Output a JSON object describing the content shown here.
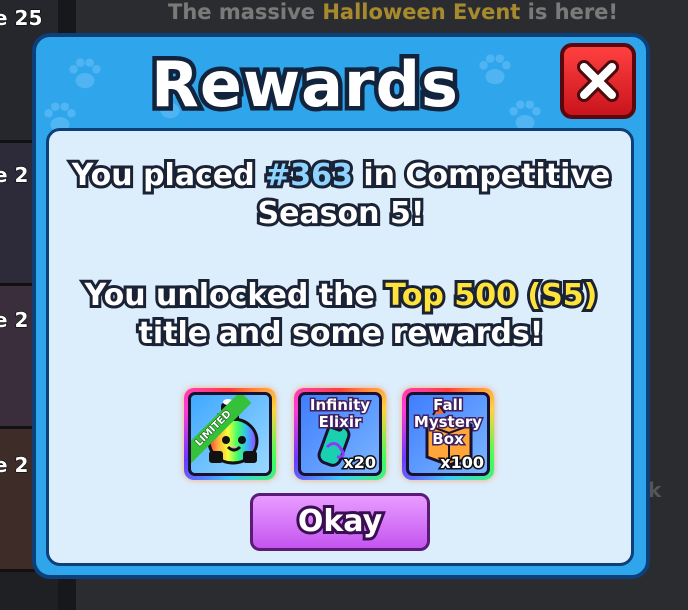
{
  "background": {
    "banner_prefix": "The massive ",
    "banner_highlight": "Halloween Event",
    "banner_suffix": " is here!",
    "side_labels": [
      "e 25",
      "e 2",
      "e 2",
      "e 2"
    ],
    "edge_glyph": "k"
  },
  "modal": {
    "title": "Rewards",
    "close_glyph": "X",
    "line1_prefix": "You placed ",
    "line1_rank": "#363",
    "line1_suffix": " in Competitive",
    "line2": "Season 5!",
    "line3_prefix": "You unlocked the ",
    "line3_title": "Top 500 (S5)",
    "line4": "title and some rewards!",
    "items": [
      {
        "name": "",
        "qty": "",
        "ribbon": "LIMITED"
      },
      {
        "name": "Infinity Elixir",
        "qty": "x20",
        "ribbon": ""
      },
      {
        "name": "Fall Mystery Box",
        "qty": "x100",
        "ribbon": ""
      }
    ],
    "okay_label": "Okay"
  },
  "colors": {
    "modal_bg": "#2fa6ec",
    "rank": "#8fd3ff",
    "title_highlight": "#ffe23a",
    "close_button": "#e0202a",
    "okay_button": "#d67af8"
  }
}
